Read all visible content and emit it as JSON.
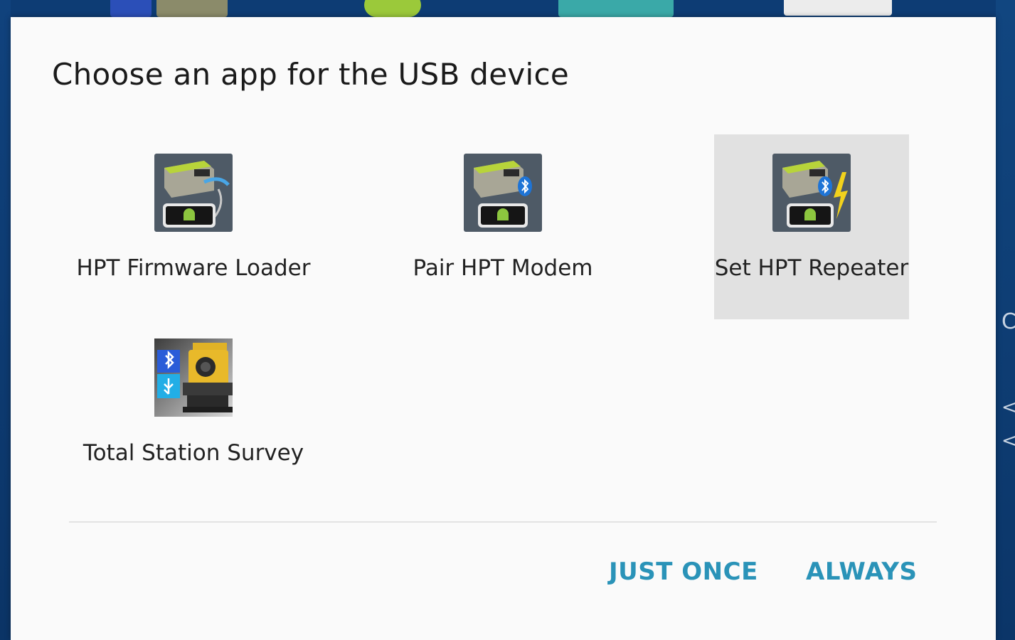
{
  "dialog": {
    "title": "Choose an app for the USB device"
  },
  "apps": [
    {
      "label": "HPT Firmware Loader",
      "icon": "hpt-firmware-loader-icon"
    },
    {
      "label": "Pair HPT Modem",
      "icon": "pair-hpt-modem-icon"
    },
    {
      "label": "Set HPT Repeater",
      "icon": "set-hpt-repeater-icon",
      "selected": true
    },
    {
      "label": "Total Station Survey",
      "icon": "total-station-survey-icon"
    }
  ],
  "actions": {
    "just_once": "JUST ONCE",
    "always": "ALWAYS"
  },
  "colors": {
    "accent": "#2a93b8",
    "dialog_bg": "#fafafa",
    "selected_bg": "#e1e1e1",
    "title": "#1a1a1a",
    "backdrop": "#0e3f78"
  }
}
